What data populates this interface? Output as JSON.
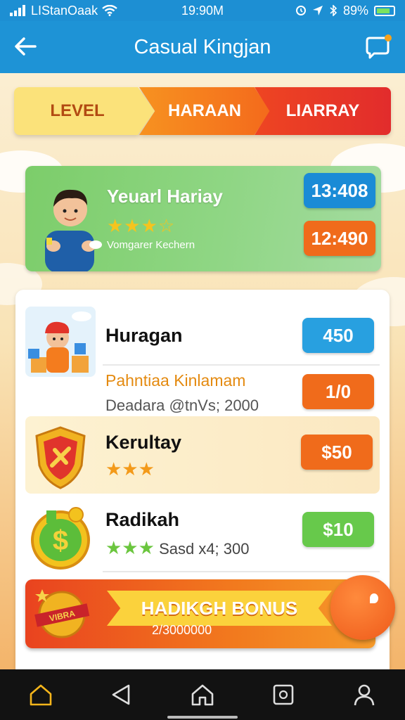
{
  "status_bar": {
    "carrier": "LIStanOaak",
    "time": "19:90M",
    "battery": "89%"
  },
  "header": {
    "title": "Casual Kingjan"
  },
  "tabs": [
    {
      "label": "LEVEL"
    },
    {
      "label": "HARAAN"
    },
    {
      "label": "LIARRAY"
    }
  ],
  "hero": {
    "name": "Yeuarl Hariay",
    "stars": "★★★☆",
    "subtitle": "Vomgarer Kechern",
    "value1": "13:408",
    "value2": "12:490"
  },
  "list": [
    {
      "name": "Huragan",
      "highlight": "Pahntiaa Kinlamam",
      "detail": "Deadara @tnVs; 2000",
      "value1": "450",
      "value2": "1/0"
    },
    {
      "name": "Kerultay",
      "stars": "★★★",
      "value": "$50"
    },
    {
      "name": "Radikah",
      "stars": "★★★",
      "detail": "Sasd x4; 300",
      "value": "$10"
    }
  ],
  "bonus": {
    "title": "HADIKGH BONUS",
    "subtitle": "2/3000000",
    "badge_text": "VIBRA"
  },
  "colors": {
    "header_blue": "#1e93d6",
    "accent_orange": "#f06b1b",
    "accent_green": "#67c94b"
  }
}
